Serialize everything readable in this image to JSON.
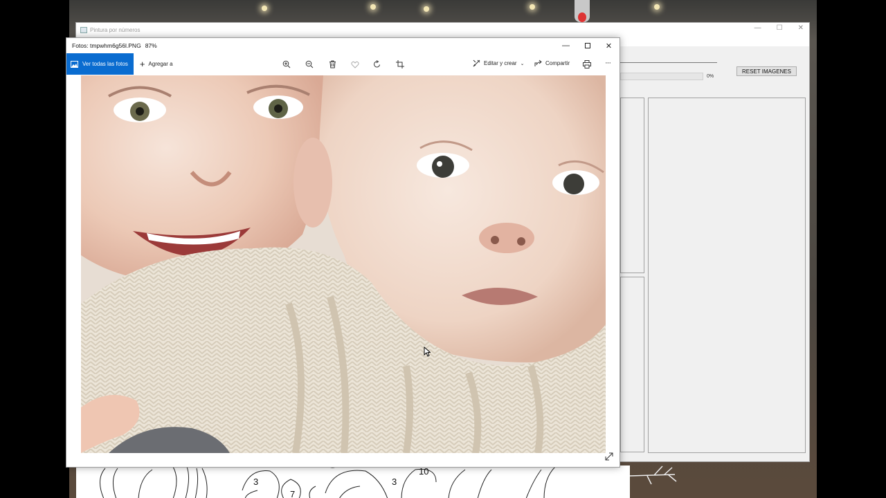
{
  "background_app": {
    "title": "Pintura por números",
    "progress_percent_label": "0%",
    "progress_fraction": 0,
    "reset_button_label": "RESET IMAGENES",
    "canvas_numbers": [
      "3",
      "7",
      "3",
      "10"
    ]
  },
  "photos_window": {
    "title": "Fotos: tmpwhm6g56l.PNG",
    "zoom": "87%",
    "toolbar": {
      "view_all_label": "Ver todas las fotos",
      "add_to_label": "Agregar a",
      "edit_create_label": "Editar y crear",
      "share_label": "Compartir",
      "more_label": "···"
    },
    "icons": [
      "zoom-in-icon",
      "zoom-out-icon",
      "delete-icon",
      "favorite-icon",
      "rotate-icon",
      "crop-icon",
      "print-icon",
      "expand-icon"
    ]
  },
  "colors": {
    "accent": "#0a6cd0",
    "window_bg": "#f0f0f0"
  }
}
